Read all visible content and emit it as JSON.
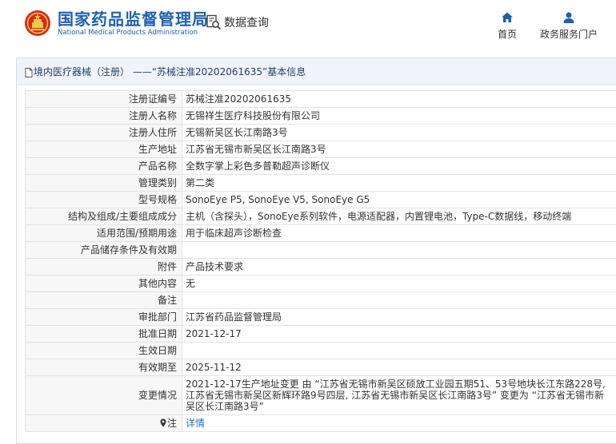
{
  "header": {
    "site_title": "国家药品监督管理局",
    "site_subtitle": "National Medical Products Administration",
    "query_label": "数据查询",
    "nav": {
      "home_label": "首页",
      "portal_label": "政务服务门户"
    }
  },
  "breadcrumb": {
    "text": "境内医疗器械（注册） ——“苏械注准20202061635”基本信息"
  },
  "rows": [
    {
      "label": "注册证编号",
      "value": "苏械注准20202061635"
    },
    {
      "label": "注册人名称",
      "value": "无锡祥生医疗科技股份有限公司"
    },
    {
      "label": "注册人住所",
      "value": "无锡新吴区长江南路3号"
    },
    {
      "label": "生产地址",
      "value": "江苏省无锡市新吴区长江南路3号"
    },
    {
      "label": "产品名称",
      "value": "全数字掌上彩色多普勒超声诊断仪"
    },
    {
      "label": "管理类别",
      "value": "第二类"
    },
    {
      "label": "型号规格",
      "value": "SonoEye P5, SonoEye V5, SonoEye G5"
    },
    {
      "label": "结构及组成/主要组成成分",
      "value": "主机（含探头），SonoEye系列软件，电源适配器，内置锂电池，Type-C数据线，移动终端"
    },
    {
      "label": "适用范围/预期用途",
      "value": "用于临床超声诊断检查"
    },
    {
      "label": "产品储存条件及有效期",
      "value": ""
    },
    {
      "label": "附件",
      "value": "产品技术要求"
    },
    {
      "label": "其他内容",
      "value": "无"
    },
    {
      "label": "备注",
      "value": ""
    },
    {
      "label": "审批部门",
      "value": "江苏省药品监督管理局"
    },
    {
      "label": "批准日期",
      "value": "2021-12-17"
    },
    {
      "label": "生效日期",
      "value": ""
    },
    {
      "label": "有效期至",
      "value": "2025-11-12"
    },
    {
      "label": "变更情况",
      "value": "2021-12-17生产地址变更 由 “江苏省无锡市新吴区硕放工业园五期51、53号地块长江东路228号, 江苏省无锡市新吴区新辉环路9号四层, 江苏省无锡市新吴区长江南路3号” 变更为 “江苏省无锡市新吴区长江南路3号”"
    }
  ],
  "note": {
    "label": "注",
    "value": "详情"
  },
  "colors": {
    "brand_blue": "#1f5fb0",
    "emblem_red": "#d52b1e",
    "emblem_gold": "#f2c84b",
    "link": "#2b6cc4"
  },
  "icons": [
    "emblem-icon",
    "magnifier-icon",
    "home-icon",
    "user-icon",
    "document-icon",
    "pin-icon"
  ]
}
